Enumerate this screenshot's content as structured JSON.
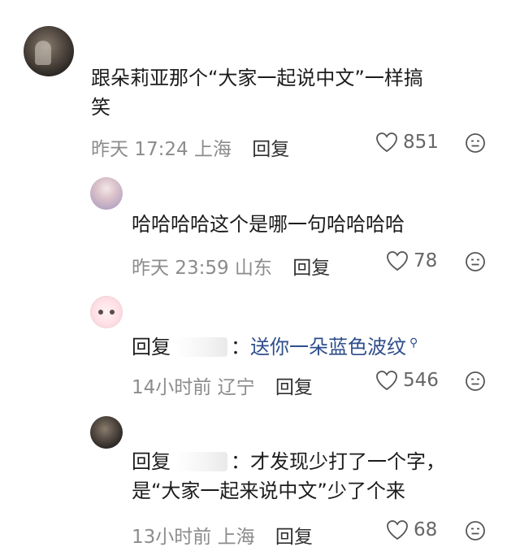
{
  "comments": [
    {
      "text_line1": "跟朵莉亚那个“大家一起说中文”一样搞",
      "text_line2": "笑",
      "time": "昨天 17:24",
      "location": "上海",
      "reply_label": "回复",
      "likes": "851",
      "avatar_icon": "user-avatar-icon"
    },
    {
      "text_line1": "哈哈哈哈这个是哪一句哈哈哈哈",
      "time": "昨天 23:59",
      "location": "山东",
      "reply_label": "回复",
      "likes": "78",
      "avatar_icon": "user-avatar-icon"
    },
    {
      "reply_prefix": "回复",
      "separator": "：",
      "content": "送你一朵蓝色波纹",
      "time": "14小时前",
      "location": "辽宁",
      "reply_label": "回复",
      "likes": "546",
      "avatar_icon": "user-avatar-icon"
    },
    {
      "reply_prefix": "回复",
      "separator": "：",
      "text_line1": "才发现少打了一个字，",
      "text_line2": "是“大家一起来说中文”少了个来",
      "time": "13小时前",
      "location": "上海",
      "reply_label": "回复",
      "likes": "68",
      "avatar_icon": "user-avatar-icon"
    }
  ],
  "icons": {
    "like": "heart-outline-icon",
    "dislike": "neutral-face-icon"
  },
  "colors": {
    "meta_gray": "#8c8c8c",
    "link_blue": "#2f4e8c",
    "text": "#1c1c1c"
  }
}
